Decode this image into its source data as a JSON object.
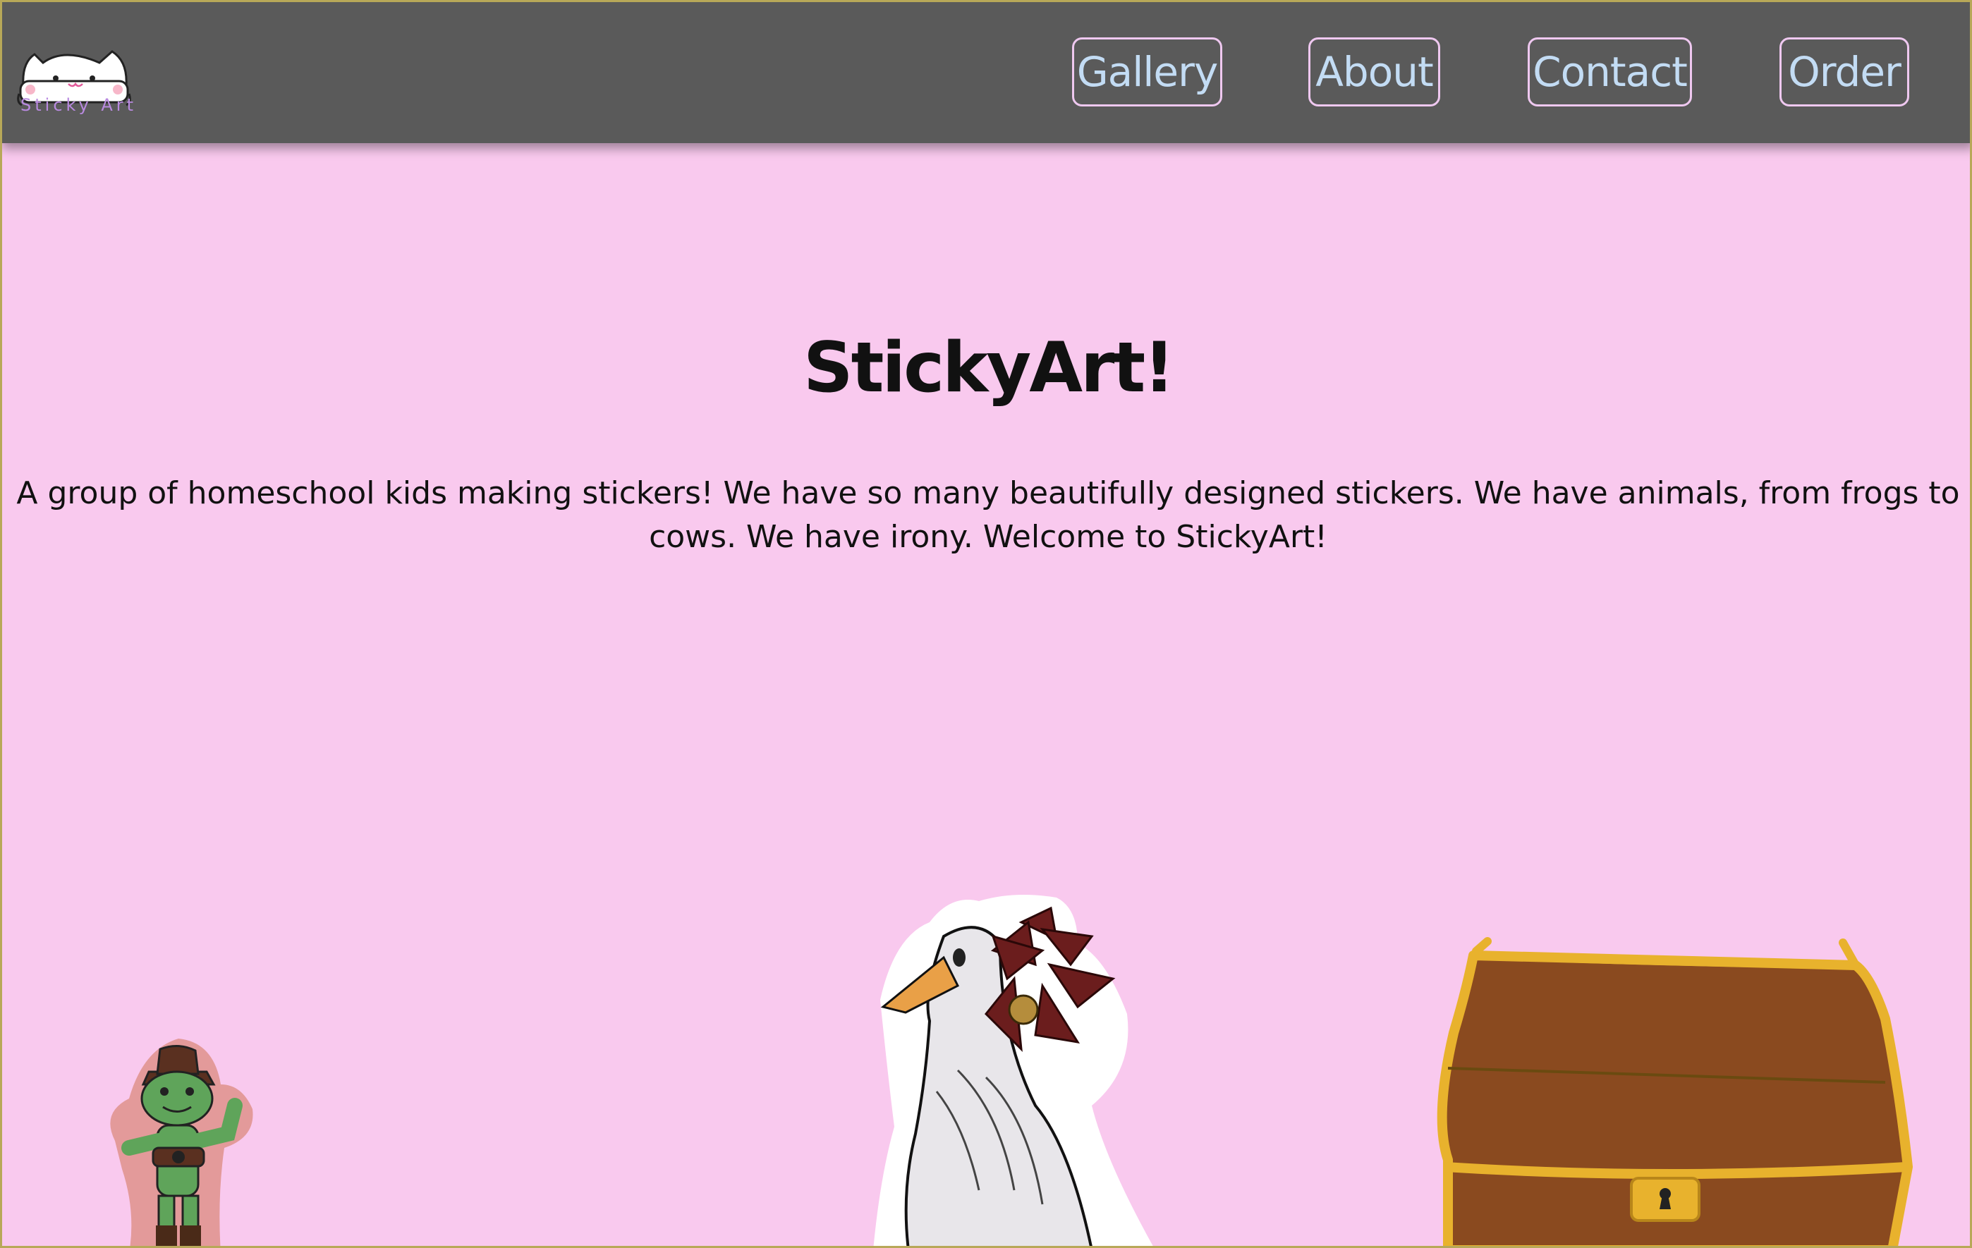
{
  "logo": {
    "text": "Sticky Art",
    "icon": "cat-icon"
  },
  "nav": {
    "items": [
      {
        "label": "Gallery"
      },
      {
        "label": "About"
      },
      {
        "label": "Contact"
      },
      {
        "label": "Order"
      }
    ]
  },
  "hero": {
    "title": "StickyArt!",
    "description": "A group of homeschool kids making stickers! We have so many beautifully designed stickers. We have animals, from frogs to cows. We have irony. Welcome to StickyArt!"
  },
  "stickers": [
    {
      "icon": "frog-cowboy-sticker"
    },
    {
      "icon": "goose-with-flower-sticker"
    },
    {
      "icon": "treasure-chest-sticker"
    }
  ],
  "colors": {
    "background": "#f9c9ee",
    "navbar": "#5a5a5a",
    "nav_text": "#c3dcf4",
    "nav_border": "#efc8f0",
    "logo_text": "#b98ae0"
  }
}
